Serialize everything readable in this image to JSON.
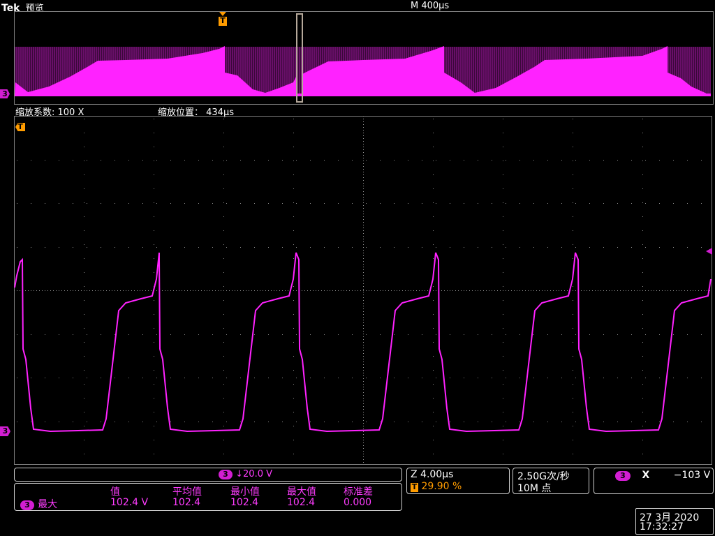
{
  "header": {
    "brand": "Tek",
    "mode": "预览",
    "timebase": "M 400µs"
  },
  "zoom": {
    "factor_label": "缩放系数: 100 X",
    "position_label": "缩放位置： 434µs"
  },
  "markers": {
    "trigger": "T",
    "channel": "3"
  },
  "channel_readout": {
    "channel": "3",
    "scale": "↓20.0 V"
  },
  "horizontal": {
    "zoom_scale": "Z 4.00µs",
    "trigger_icon": "T",
    "trigger_pos": "29.90 %"
  },
  "acquisition": {
    "rate": "2.50G次/秒",
    "record": "10M 点"
  },
  "trigger_readout": {
    "channel": "3",
    "slope_symbol": "X",
    "level": "−103 V"
  },
  "measurements": {
    "channel": "3",
    "name": "最大",
    "headers": [
      "值",
      "平均值",
      "最小值",
      "最大值",
      "标准差"
    ],
    "values": [
      "102.4 V",
      "102.4",
      "102.4",
      "102.4",
      "0.000"
    ]
  },
  "datetime": {
    "date": "27 3月  2020",
    "time": "17:32:27"
  },
  "colors": {
    "trace": "#ff22ff",
    "trigger": "#ff9c00",
    "channel": "#d21ed2"
  }
}
